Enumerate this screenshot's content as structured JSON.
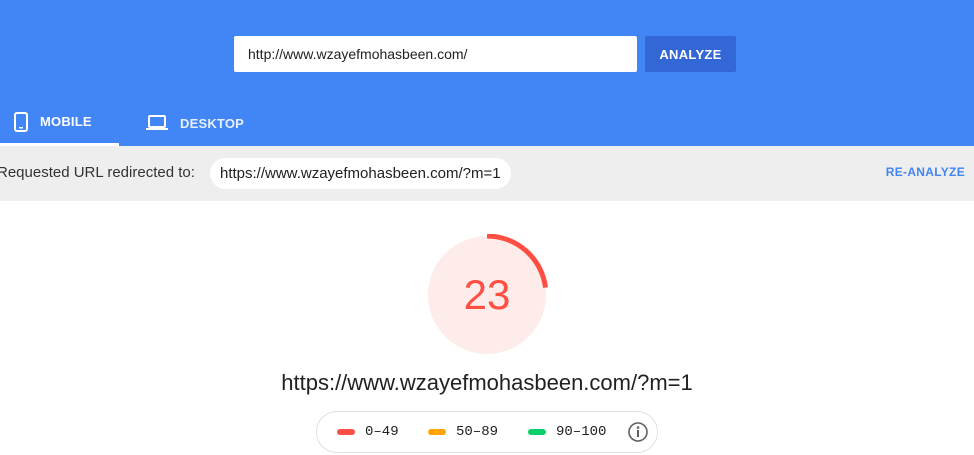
{
  "search": {
    "value": "http://www.wzayefmohasbeen.com/",
    "button_label": "ANALYZE"
  },
  "tabs": [
    {
      "label": "MOBILE",
      "icon": "smartphone-icon",
      "selected": true
    },
    {
      "label": "DESKTOP",
      "icon": "laptop-icon",
      "selected": false
    }
  ],
  "redirect": {
    "label": "Requested URL redirected to:",
    "url": "https://www.wzayefmohasbeen.com/?m=1",
    "reanalyze_label": "RE-ANALYZE"
  },
  "score": {
    "value": "23",
    "fraction": 0.23,
    "color": "#ff4e42",
    "background": "#fdecea"
  },
  "final_url": "https://www.wzayefmohasbeen.com/?m=1",
  "legend": {
    "items": [
      {
        "range": "0–49",
        "color": "#ff4e42"
      },
      {
        "range": "50–89",
        "color": "#ffa400"
      },
      {
        "range": "90–100",
        "color": "#0cce6b"
      }
    ],
    "info_icon": "info-icon"
  },
  "colors": {
    "header": "#4285f4",
    "accent_button": "#3367d6",
    "link": "#4285f4"
  }
}
